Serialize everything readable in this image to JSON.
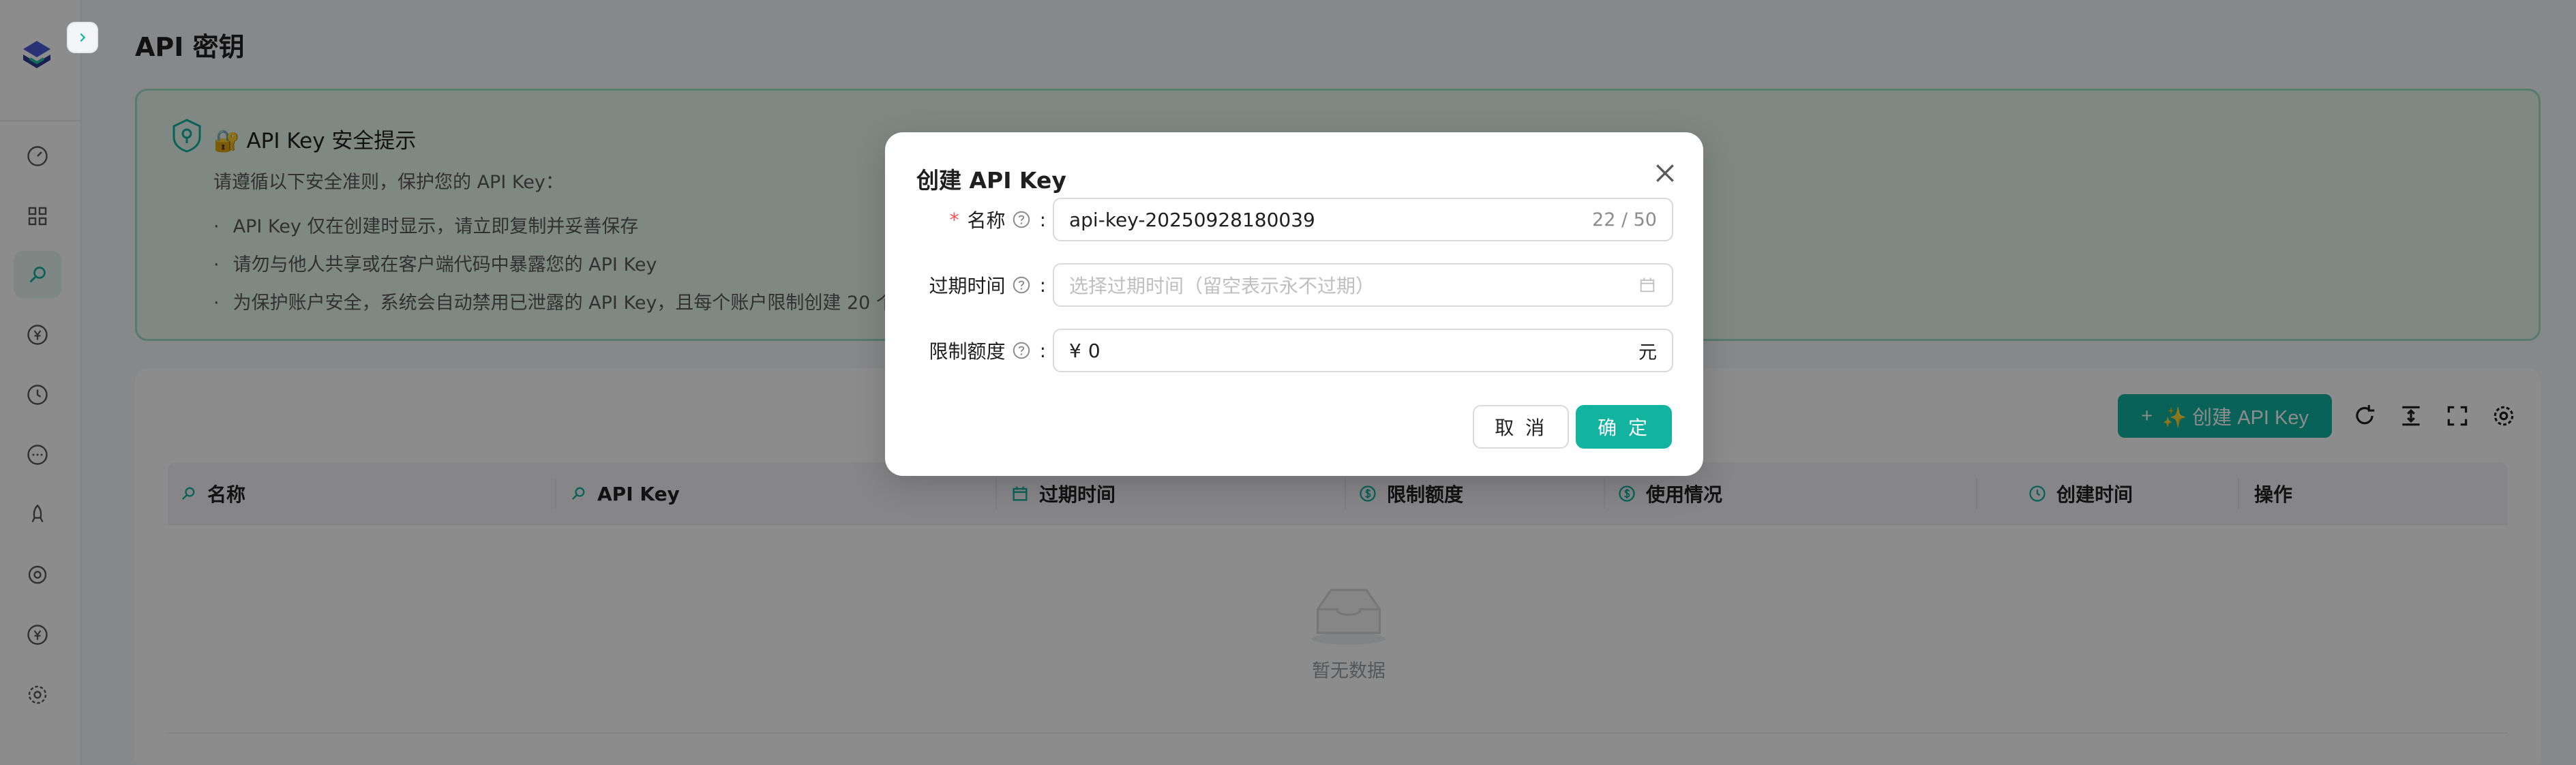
{
  "page": {
    "title": "API 密钥"
  },
  "sidebar": {
    "items": [
      {
        "icon": "dashboard-icon"
      },
      {
        "icon": "grid-icon"
      },
      {
        "icon": "key-search-icon",
        "active": true
      },
      {
        "icon": "yuan-icon"
      },
      {
        "icon": "history-icon"
      },
      {
        "icon": "chat-icon"
      },
      {
        "icon": "rocket-icon"
      },
      {
        "icon": "ai-model-icon"
      },
      {
        "icon": "yuan-circle-icon"
      },
      {
        "icon": "settings-icon"
      }
    ]
  },
  "alert": {
    "title": "🔐 API Key 安全提示",
    "lead": "请遵循以下安全准则，保护您的 API Key：",
    "items": [
      "API Key 仅在创建时显示，请立即复制并妥善保存",
      "请勿与他人共享或在客户端代码中暴露您的 API Key",
      "为保护账户安全，系统会自动禁用已泄露的 API Key，且每个账户限制创建 20 个"
    ]
  },
  "toolbar": {
    "create_label": "✨ 创建 API Key"
  },
  "table": {
    "columns": [
      "名称",
      "API Key",
      "过期时间",
      "限制额度",
      "使用情况",
      "创建时间",
      "操作"
    ],
    "empty_text": "暂无数据"
  },
  "modal": {
    "title": "创建 API Key",
    "fields": {
      "name": {
        "label": "名称",
        "value": "api-key-20250928180039",
        "counter": "22 / 50",
        "required": true
      },
      "expire": {
        "label": "过期时间",
        "placeholder": "选择过期时间（留空表示永不过期）"
      },
      "quota": {
        "label": "限制额度",
        "prefix": "¥",
        "value": "0",
        "suffix": "元"
      }
    },
    "cancel_label": "取 消",
    "ok_label": "确 定"
  },
  "colors": {
    "accent": "#12b39f",
    "alert_bg": "#e9f8f1",
    "alert_border": "#9fe1c6"
  }
}
